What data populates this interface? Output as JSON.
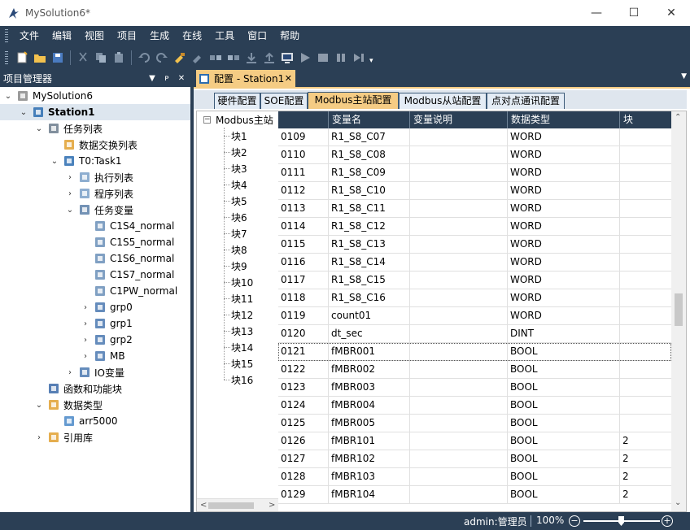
{
  "window": {
    "title": "MySolution6*",
    "minimize": "—",
    "maximize": "☐",
    "close": "✕"
  },
  "menu": [
    "文件",
    "编辑",
    "视图",
    "项目",
    "生成",
    "在线",
    "工具",
    "窗口",
    "帮助"
  ],
  "left_panel": {
    "title": "项目管理器",
    "tree": [
      {
        "label": "MySolution6",
        "depth": 0,
        "chevron": "v",
        "icon": "solution-icon"
      },
      {
        "label": "Station1",
        "depth": 1,
        "chevron": "v",
        "icon": "station-icon",
        "bold": true,
        "selected": true
      },
      {
        "label": "任务列表",
        "depth": 2,
        "chevron": "v",
        "icon": "task-list-icon"
      },
      {
        "label": "数据交换列表",
        "depth": 3,
        "chevron": "",
        "icon": "exchange-icon"
      },
      {
        "label": "T0:Task1",
        "depth": 3,
        "chevron": "v",
        "icon": "checked-task-icon"
      },
      {
        "label": "执行列表",
        "depth": 4,
        "chevron": ">",
        "icon": "grid-icon"
      },
      {
        "label": "程序列表",
        "depth": 4,
        "chevron": ">",
        "icon": "program-icon"
      },
      {
        "label": "任务变量",
        "depth": 4,
        "chevron": "v",
        "icon": "variable-icon"
      },
      {
        "label": "C1S4_normal",
        "depth": 5,
        "chevron": "",
        "icon": "var-item-icon"
      },
      {
        "label": "C1S5_normal",
        "depth": 5,
        "chevron": "",
        "icon": "var-item-icon"
      },
      {
        "label": "C1S6_normal",
        "depth": 5,
        "chevron": "",
        "icon": "var-item-icon"
      },
      {
        "label": "C1S7_normal",
        "depth": 5,
        "chevron": "",
        "icon": "var-item-icon"
      },
      {
        "label": "C1PW_normal",
        "depth": 5,
        "chevron": "",
        "icon": "var-item-icon"
      },
      {
        "label": "grp0",
        "depth": 5,
        "chevron": ">",
        "icon": "group-icon"
      },
      {
        "label": "grp1",
        "depth": 5,
        "chevron": ">",
        "icon": "group-icon"
      },
      {
        "label": "grp2",
        "depth": 5,
        "chevron": ">",
        "icon": "group-icon"
      },
      {
        "label": "MB",
        "depth": 5,
        "chevron": ">",
        "icon": "group-icon"
      },
      {
        "label": "IO变量",
        "depth": 4,
        "chevron": ">",
        "icon": "io-icon"
      },
      {
        "label": "函数和功能块",
        "depth": 2,
        "chevron": "",
        "icon": "function-icon"
      },
      {
        "label": "数据类型",
        "depth": 2,
        "chevron": "v",
        "icon": "datatype-icon"
      },
      {
        "label": "arr5000",
        "depth": 3,
        "chevron": "",
        "icon": "array-icon"
      },
      {
        "label": "引用库",
        "depth": 2,
        "chevron": ">",
        "icon": "library-icon"
      }
    ]
  },
  "doc_tab": {
    "label": "配置 - Station1",
    "close": "✕"
  },
  "config_tabs": [
    {
      "label": "硬件配置",
      "active": false
    },
    {
      "label": "SOE配置",
      "active": false
    },
    {
      "label": "Modbus主站配置",
      "active": true
    },
    {
      "label": "Modbus从站配置",
      "active": false
    },
    {
      "label": "点对点通讯配置",
      "active": false
    }
  ],
  "block_tree": {
    "root": "Modbus主站",
    "toggle": "−",
    "items": [
      "块1",
      "块2",
      "块3",
      "块4",
      "块5",
      "块6",
      "块7",
      "块8",
      "块9",
      "块10",
      "块11",
      "块12",
      "块13",
      "块14",
      "块15",
      "块16"
    ]
  },
  "grid": {
    "columns": [
      "",
      "变量名",
      "变量说明",
      "数据类型",
      "块"
    ],
    "rows": [
      [
        "0109",
        "R1_S8_C07",
        "",
        "WORD",
        ""
      ],
      [
        "0110",
        "R1_S8_C08",
        "",
        "WORD",
        ""
      ],
      [
        "0111",
        "R1_S8_C09",
        "",
        "WORD",
        ""
      ],
      [
        "0112",
        "R1_S8_C10",
        "",
        "WORD",
        ""
      ],
      [
        "0113",
        "R1_S8_C11",
        "",
        "WORD",
        ""
      ],
      [
        "0114",
        "R1_S8_C12",
        "",
        "WORD",
        ""
      ],
      [
        "0115",
        "R1_S8_C13",
        "",
        "WORD",
        ""
      ],
      [
        "0116",
        "R1_S8_C14",
        "",
        "WORD",
        ""
      ],
      [
        "0117",
        "R1_S8_C15",
        "",
        "WORD",
        ""
      ],
      [
        "0118",
        "R1_S8_C16",
        "",
        "WORD",
        ""
      ],
      [
        "0119",
        "count01",
        "",
        "WORD",
        ""
      ],
      [
        "0120",
        "dt_sec",
        "",
        "DINT",
        ""
      ],
      [
        "0121",
        "fMBR001",
        "",
        "BOOL",
        ""
      ],
      [
        "0122",
        "fMBR002",
        "",
        "BOOL",
        ""
      ],
      [
        "0123",
        "fMBR003",
        "",
        "BOOL",
        ""
      ],
      [
        "0124",
        "fMBR004",
        "",
        "BOOL",
        ""
      ],
      [
        "0125",
        "fMBR005",
        "",
        "BOOL",
        ""
      ],
      [
        "0126",
        "fMBR101",
        "",
        "BOOL",
        "2"
      ],
      [
        "0127",
        "fMBR102",
        "",
        "BOOL",
        "2"
      ],
      [
        "0128",
        "fMBR103",
        "",
        "BOOL",
        "2"
      ],
      [
        "0129",
        "fMBR104",
        "",
        "BOOL",
        "2"
      ]
    ],
    "focused_row": 12
  },
  "status": {
    "user": "admin:管理员",
    "zoom": "100%",
    "zoom_level_percent": 100
  },
  "colors": {
    "chrome": "#2b3f55",
    "accent": "#f5cc84",
    "selection": "#dde6ef"
  }
}
